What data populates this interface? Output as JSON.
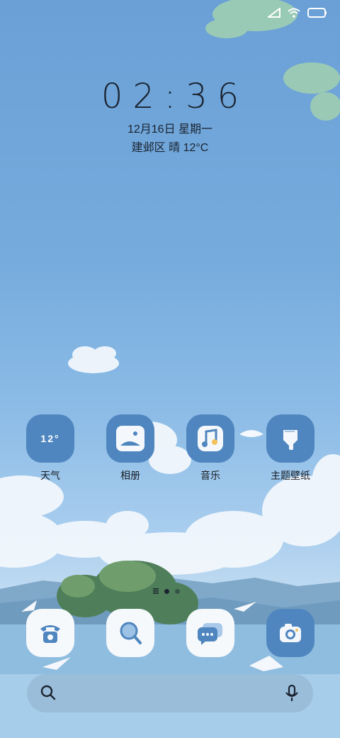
{
  "lockscreen": {
    "time": "02:36",
    "date": "12月16日 星期一",
    "weather": "建邺区 晴 12°C"
  },
  "status_bar": {
    "icons": [
      "signal-icon",
      "wifi-icon",
      "battery-icon"
    ]
  },
  "apps": [
    {
      "name": "weather",
      "label": "天气",
      "icon_text": "12°"
    },
    {
      "name": "gallery",
      "label": "相册"
    },
    {
      "name": "music",
      "label": "音乐"
    },
    {
      "name": "themes",
      "label": "主题壁纸"
    }
  ],
  "dock": [
    {
      "name": "phone",
      "icon": "phone-icon"
    },
    {
      "name": "browser",
      "icon": "magnifier-icon"
    },
    {
      "name": "messages",
      "icon": "chat-icon"
    },
    {
      "name": "camera",
      "icon": "camera-icon"
    }
  ],
  "page_indicator": {
    "pages": 2,
    "current": 1
  },
  "colors": {
    "icon_blue": "#4f86bf",
    "icon_white": "#f6f9fc",
    "text_dark": "#1b2430"
  }
}
